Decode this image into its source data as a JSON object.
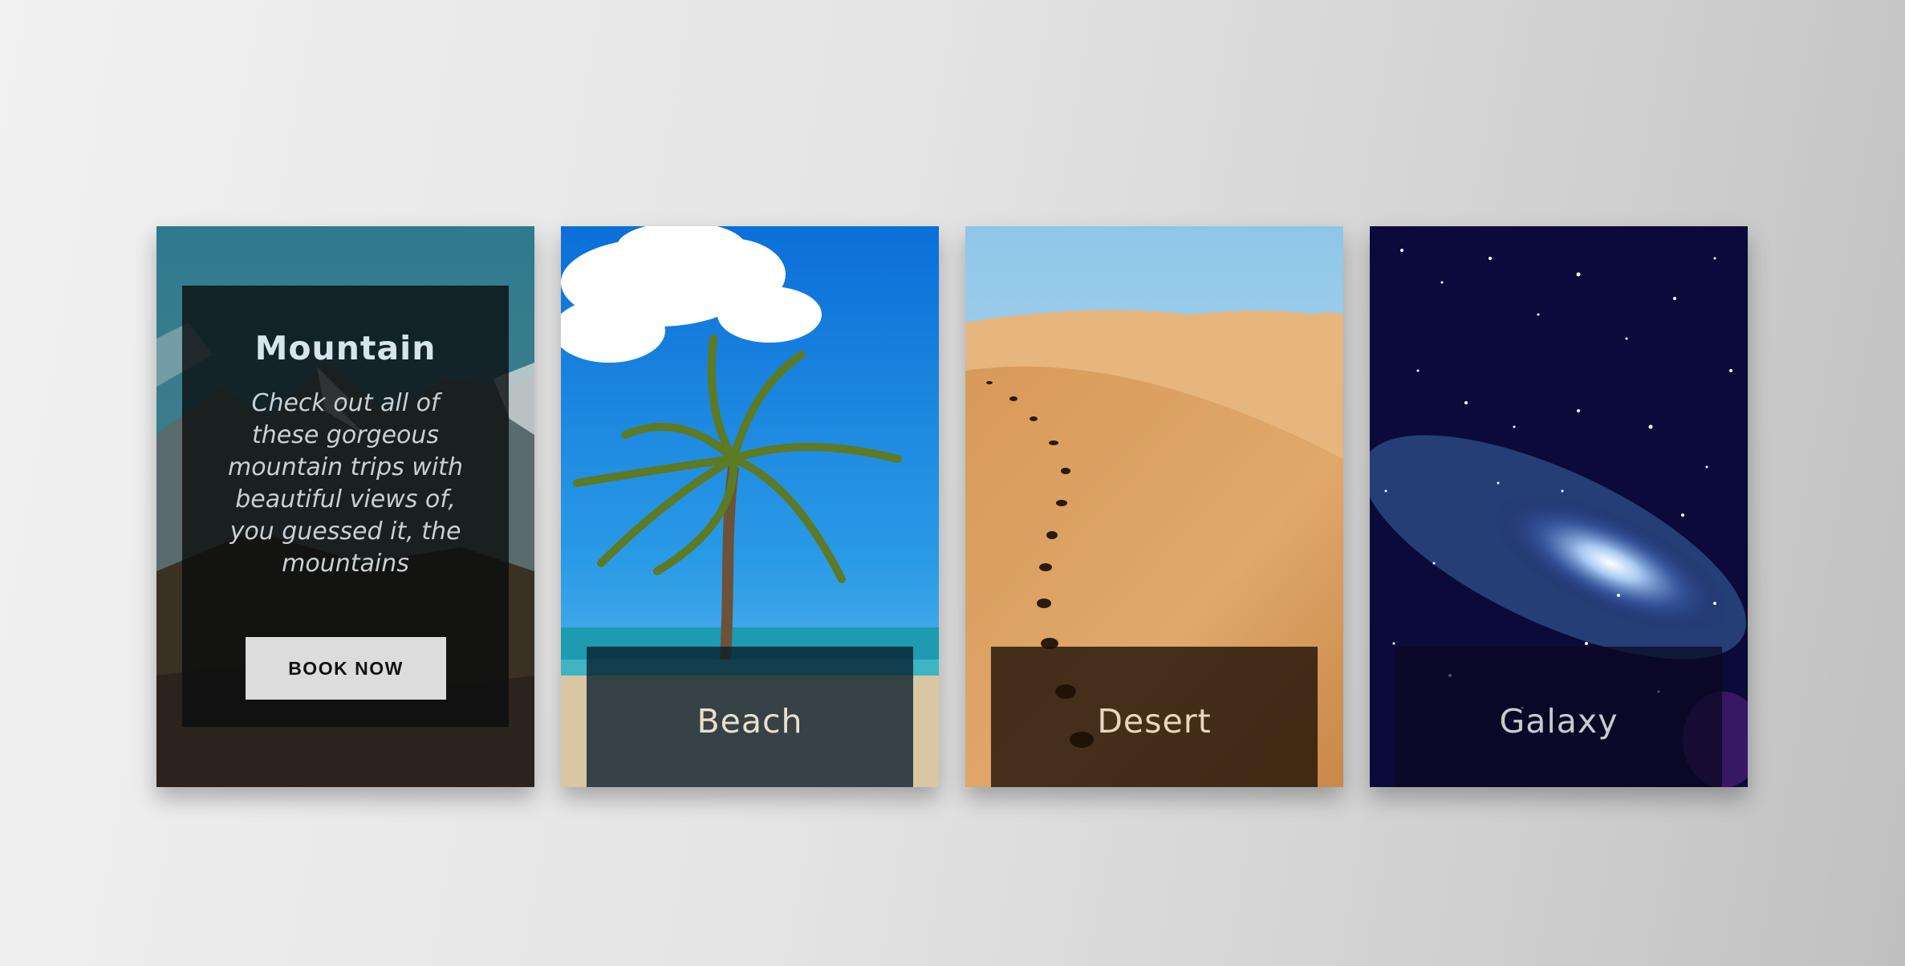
{
  "cards": [
    {
      "id": "mountain",
      "title": "Mountain",
      "description": "Check out all of these gorgeous mountain trips with beautiful views of, you guessed it, the mountains",
      "button_label": "BOOK NOW",
      "state": "expanded"
    },
    {
      "id": "beach",
      "title": "Beach",
      "state": "collapsed"
    },
    {
      "id": "desert",
      "title": "Desert",
      "state": "collapsed"
    },
    {
      "id": "galaxy",
      "title": "Galaxy",
      "state": "collapsed"
    }
  ],
  "colors": {
    "page_background": "#e4e4e4",
    "mountain_overlay": "#0a0c0e",
    "button_background": "#dcdcdc",
    "title_text": "#d7e4ec"
  }
}
